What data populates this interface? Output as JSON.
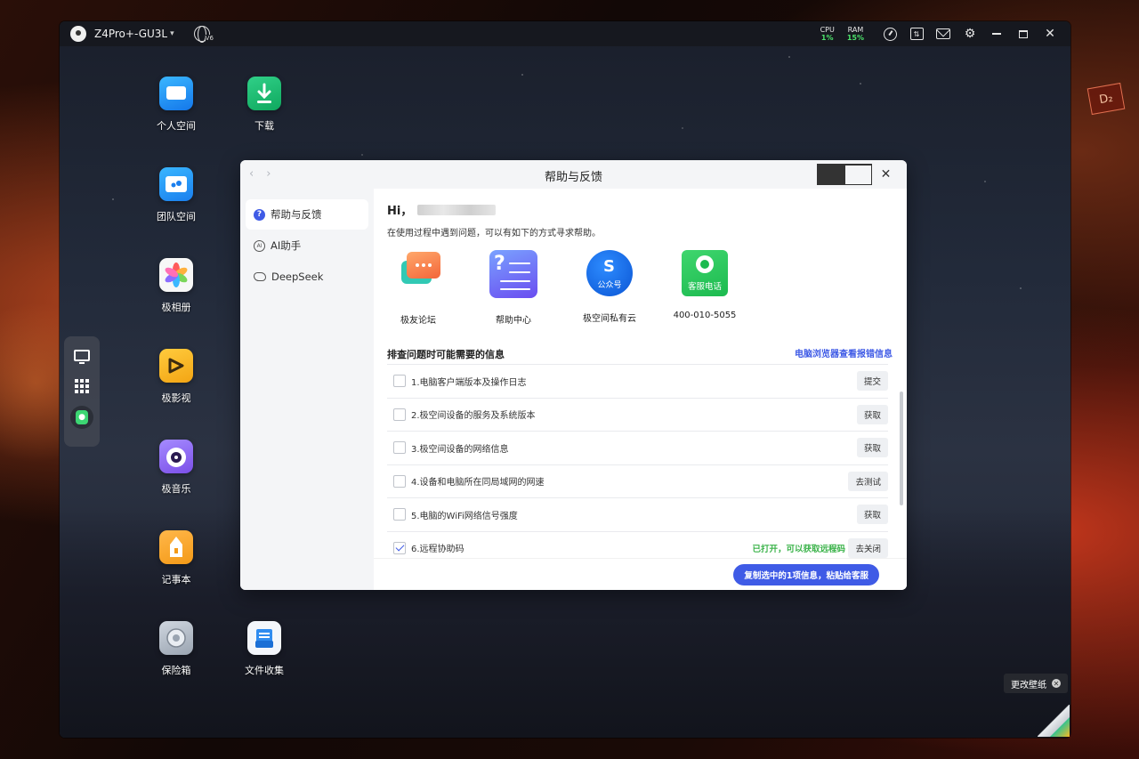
{
  "topbar": {
    "device_name": "Z4Pro+-GU3L",
    "globe_badge": "V6",
    "cpu_label": "CPU",
    "cpu_value": "1%",
    "ram_label": "RAM",
    "ram_value": "15%"
  },
  "desktop_icons": [
    {
      "label": "个人空间"
    },
    {
      "label": "下载"
    },
    {
      "label": "团队空间"
    },
    {
      "label": "极相册"
    },
    {
      "label": "极影视"
    },
    {
      "label": "极音乐"
    },
    {
      "label": "记事本"
    },
    {
      "label": "保险箱"
    },
    {
      "label": "文件收集"
    }
  ],
  "dialog": {
    "title": "帮助与反馈",
    "sidebar": [
      {
        "label": "帮助与反馈"
      },
      {
        "label": "AI助手"
      },
      {
        "label": "DeepSeek"
      }
    ],
    "greeting": "Hi，",
    "intro": "在使用过程中遇到问题，可以有如下的方式寻求帮助。",
    "channels": [
      {
        "label": "极友论坛"
      },
      {
        "label": "帮助中心"
      },
      {
        "label": "极空间私有云",
        "icon_text": "公众号"
      },
      {
        "label": "400-010-5055",
        "icon_text": "客服电话"
      }
    ],
    "section_title": "排查问题时可能需要的信息",
    "section_link": "电脑浏览器查看报错信息",
    "rows": [
      {
        "label": "1.电脑客户端版本及操作日志",
        "button": "提交",
        "checked": false
      },
      {
        "label": "2.极空间设备的服务及系统版本",
        "button": "获取",
        "checked": false
      },
      {
        "label": "3.极空间设备的网络信息",
        "button": "获取",
        "checked": false
      },
      {
        "label": "4.设备和电脑所在同局域网的网速",
        "button": "去测试",
        "checked": false
      },
      {
        "label": "5.电脑的WiFi网络信号强度",
        "button": "获取",
        "checked": false
      },
      {
        "label": "6.远程协助码",
        "button": "去关闭",
        "checked": true,
        "status": "已打开，可以获取远程码"
      }
    ],
    "copy_button": "复制选中的1项信息，粘贴给客服"
  },
  "wallpaper_tip": "更改壁纸",
  "colors": {
    "accent": "#3f5be6",
    "status_green": "#3bb34a",
    "cpu_green": "#4ce06a"
  }
}
